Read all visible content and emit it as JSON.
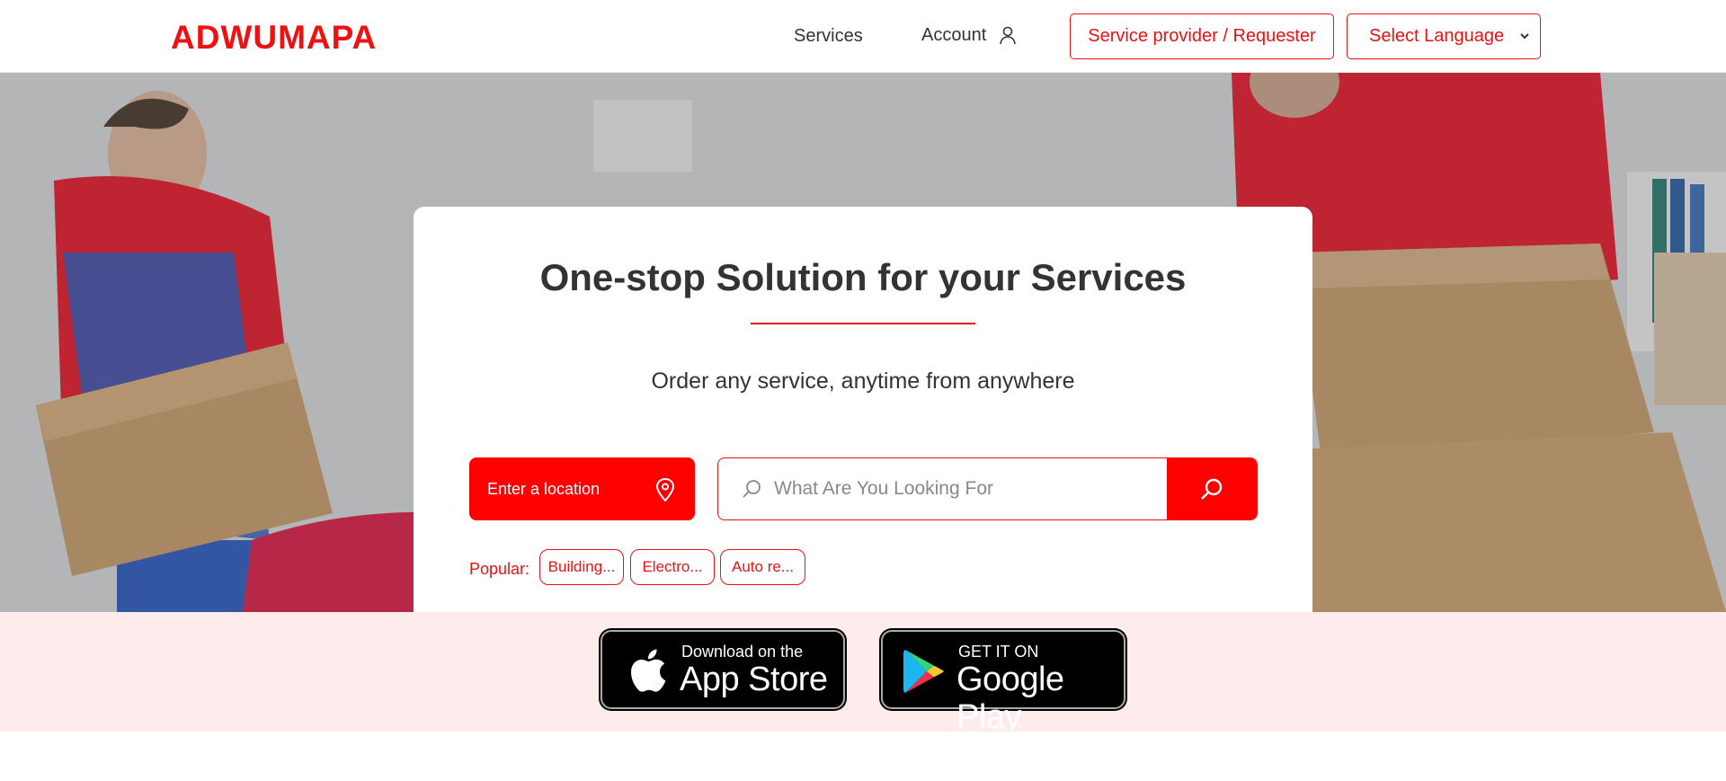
{
  "header": {
    "logo_text": "ADWUMAPA",
    "nav": {
      "services_label": "Services",
      "account_label": "Account"
    },
    "provider_button_label": "Service provider / Requester",
    "language_select": {
      "selected": "Select Language"
    }
  },
  "hero": {
    "title": "One-stop Solution for your Services",
    "subtitle": "Order any service, anytime from anywhere",
    "location_button_label": "Enter a location",
    "search": {
      "placeholder": "What Are You Looking For"
    },
    "popular": {
      "label": "Popular:",
      "chips": [
        "Building...",
        "Electro...",
        "Auto re..."
      ]
    }
  },
  "downloads": {
    "app_store": {
      "line1": "Download on the",
      "line2": "App Store"
    },
    "google_play": {
      "line1": "GET IT ON",
      "line2": "Google Play"
    }
  },
  "colors": {
    "accent": "#ee1111",
    "button_red": "#ff0000",
    "band_background": "#feebeb",
    "text_dark": "#333333"
  },
  "icons": [
    "user-icon",
    "chevron-down-icon",
    "location-pin-icon",
    "search-icon",
    "apple-icon",
    "google-play-icon"
  ]
}
